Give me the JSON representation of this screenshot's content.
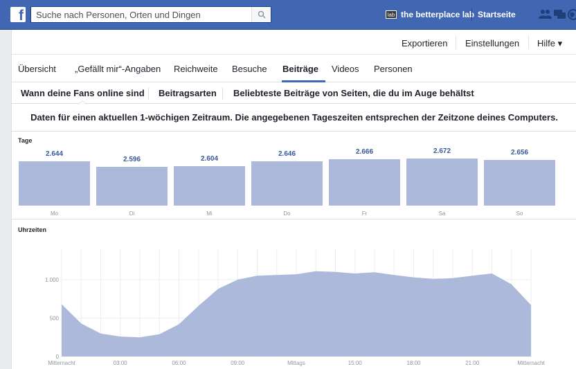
{
  "topbar": {
    "logo": "f",
    "search_placeholder": "Suche nach Personen, Orten und Dingen",
    "page_thumb": "lab",
    "page_name": "the betterplace lab",
    "home": "Startseite"
  },
  "actions": {
    "export": "Exportieren",
    "settings": "Einstellungen",
    "help": "Hilfe ▾"
  },
  "tabs": [
    "Übersicht",
    "„Gefällt mir“-Angaben",
    "Reichweite",
    "Besuche",
    "Beiträge",
    "Videos",
    "Personen"
  ],
  "active_tab": "Beiträge",
  "subtabs": [
    "Wann deine Fans online sind",
    "Beitragsarten",
    "Beliebteste Beiträge von Seiten, die du im Auge behältst"
  ],
  "info": "Daten für einen aktuellen 1-wöchigen Zeitraum. Die angegebenen Tageszeiten entsprechen der Zeitzone deines Computers.",
  "colors": {
    "brand": "#4267b2",
    "bar": "#adb9da",
    "value_text": "#365899"
  },
  "chart_data": [
    {
      "type": "bar",
      "title": "Tage",
      "categories": [
        "Mo",
        "Di",
        "Mi",
        "Do",
        "Fr",
        "Sa",
        "So"
      ],
      "values": [
        2644,
        2596,
        2604,
        2646,
        2666,
        2672,
        2656
      ],
      "value_labels": [
        "2.644",
        "2.596",
        "2.604",
        "2.646",
        "2.666",
        "2.672",
        "2.656"
      ]
    },
    {
      "type": "area",
      "title": "Uhrzeiten",
      "x": [
        0,
        1,
        2,
        3,
        4,
        5,
        6,
        7,
        8,
        9,
        10,
        11,
        12,
        13,
        14,
        15,
        16,
        17,
        18,
        19,
        20,
        21,
        22,
        23
      ],
      "values": [
        680,
        430,
        300,
        260,
        250,
        290,
        420,
        660,
        880,
        1000,
        1050,
        1060,
        1070,
        1110,
        1100,
        1080,
        1095,
        1060,
        1030,
        1010,
        1020,
        1050,
        1080,
        940,
        670
      ],
      "x_tick_labels": [
        "Mitternacht",
        "03:00",
        "06:00",
        "09:00",
        "Mittags",
        "15:00",
        "18:00",
        "21:00",
        "Mitternacht"
      ],
      "y_tick_labels": [
        "0",
        "500",
        "1.000"
      ],
      "ylim": [
        0,
        1350
      ],
      "grid": true
    }
  ]
}
